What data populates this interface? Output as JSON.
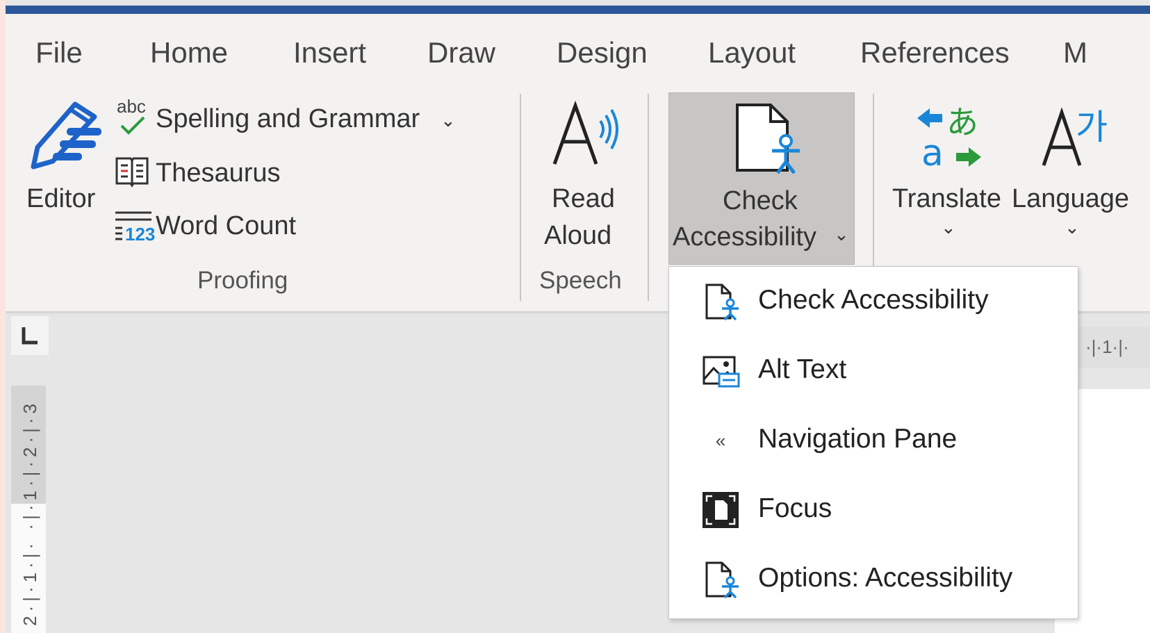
{
  "tabs": [
    "File",
    "Home",
    "Insert",
    "Draw",
    "Design",
    "Layout",
    "References",
    "M"
  ],
  "proofing": {
    "editor_label": "Editor",
    "abc_label": "abc",
    "spelling_label": "Spelling and Grammar",
    "thesaurus_label": "Thesaurus",
    "wordcount_label": "Word Count",
    "wordcount_icon_text": "123",
    "group_label": "Proofing"
  },
  "speech": {
    "read_label_line1": "Read",
    "read_label_line2": "Aloud",
    "group_label": "Speech"
  },
  "accessibility": {
    "check_label_line1": "Check",
    "check_label_line2": "Accessibility"
  },
  "language": {
    "translate_label": "Translate",
    "language_label": "Language"
  },
  "ruler": {
    "vertical_text": "2·|·1·|·  ·|·1·|·2·|·3",
    "horizontal_text": "·|·1·|·"
  },
  "dropdown": {
    "items": [
      {
        "label": "Check Accessibility",
        "icon": "check-accessibility-icon"
      },
      {
        "label": "Alt Text",
        "icon": "alt-text-icon"
      },
      {
        "label": "Navigation Pane",
        "icon": "navigation-pane-icon"
      },
      {
        "label": "Focus",
        "icon": "focus-icon"
      },
      {
        "label": "Options: Accessibility",
        "icon": "options-accessibility-icon"
      }
    ]
  },
  "colors": {
    "title_bar": "#2b579a",
    "ribbon": "#f3f2f1",
    "editor_blue": "#1e63c9",
    "translate_green": "#2a9a3a",
    "accent_blue": "#1a86d9"
  }
}
